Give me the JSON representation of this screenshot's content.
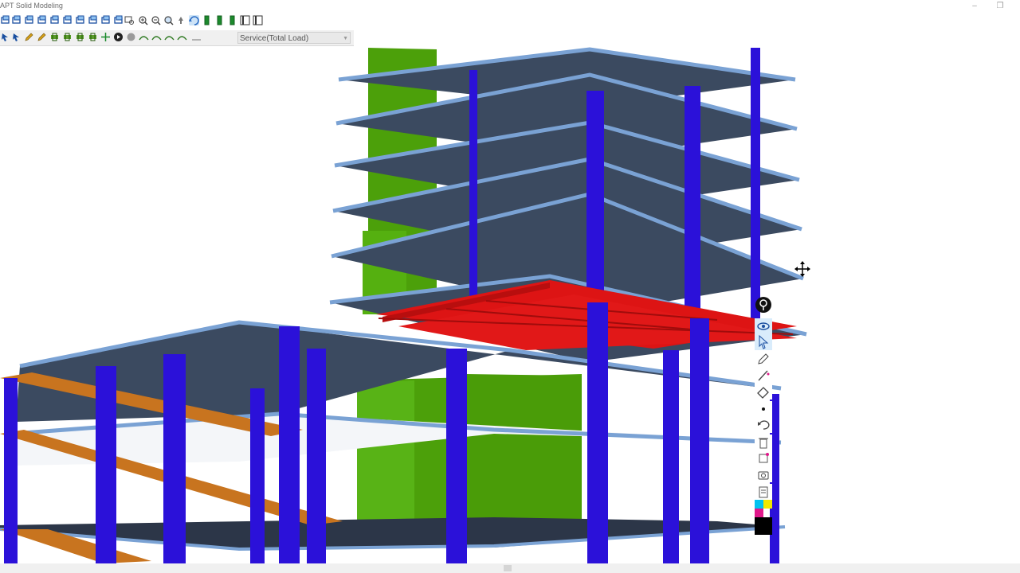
{
  "window": {
    "title": "APT Solid Modeling",
    "controls": [
      {
        "name": "minimize-button",
        "glyph": "–"
      },
      {
        "name": "restore-button",
        "glyph": "❐"
      }
    ]
  },
  "toolbar_top": {
    "icons": [
      "view-icon",
      "view-icon",
      "view-icon",
      "view-icon",
      "view-icon",
      "view-icon",
      "view-icon",
      "view-icon",
      "view-icon",
      "view-icon",
      "zoom-window-icon",
      "zoom-in-icon",
      "zoom-out-icon",
      "zoom-extents-icon",
      "pan-icon",
      "rotate-icon",
      "column-icon",
      "column-icon",
      "column-icon",
      "display-icon",
      "display-icon"
    ]
  },
  "toolbar_second": {
    "icons": [
      "select-icon",
      "select-icon",
      "edit-icon",
      "edit-icon",
      "component-icon",
      "component-icon",
      "component-icon",
      "component-icon",
      "move-icon",
      "play-icon",
      "sphere-icon",
      "tendon-icon",
      "tendon-icon",
      "tendon-icon",
      "tendon-icon",
      "line-icon"
    ],
    "load_combo": "Service(Total Load)"
  },
  "colors": {
    "slab": "#3b4a60",
    "slab_edge": "#7aa2d4",
    "column": "#2b11d9",
    "wall": "#4ca00a",
    "beam_red": "#dd1414",
    "beam_orange": "#c8741f"
  },
  "ink_palette": {
    "items": [
      "pin-icon",
      "eye-icon",
      "pointer-icon",
      "pen-icon",
      "highlighter-icon",
      "eraser-icon",
      "dot-icon",
      "undo-icon",
      "trash-icon",
      "clear-icon",
      "camera-icon",
      "clipboard-icon",
      "color-swatch-icon"
    ]
  }
}
